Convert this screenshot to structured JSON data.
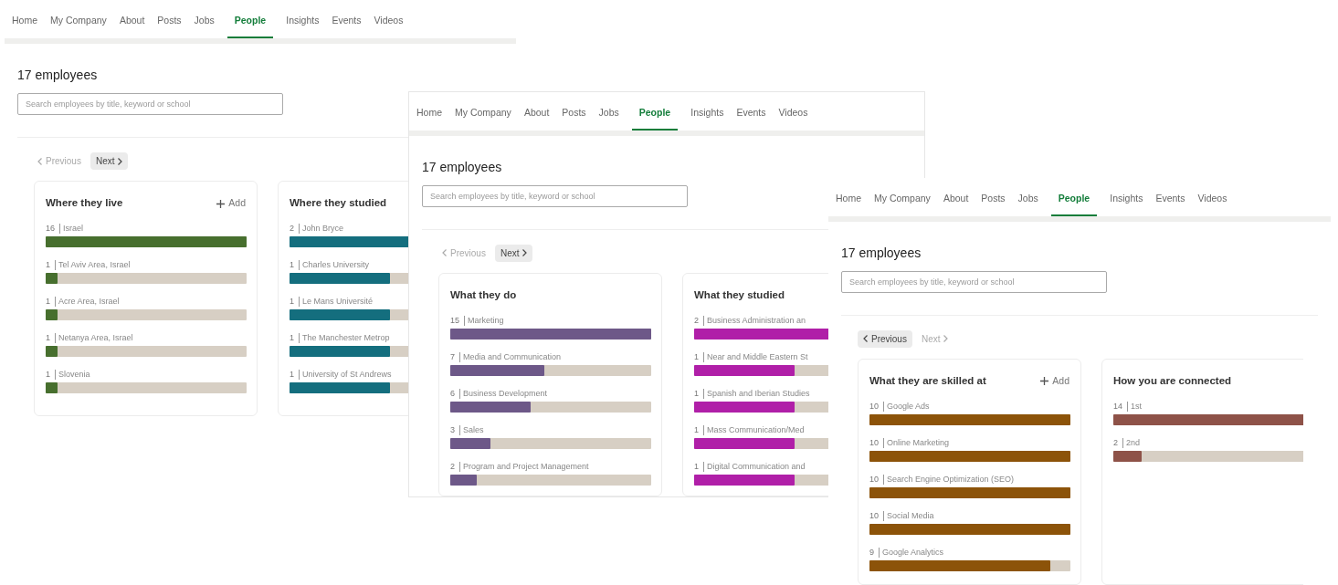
{
  "windows": [
    {
      "tabs": [
        {
          "label": "Home",
          "selected": false
        },
        {
          "label": "My Company",
          "selected": false
        },
        {
          "label": "About",
          "selected": false
        },
        {
          "label": "Posts",
          "selected": false
        },
        {
          "label": "Jobs",
          "selected": false
        },
        {
          "label": "People",
          "selected": true
        },
        {
          "label": "Insights",
          "selected": false
        },
        {
          "label": "Events",
          "selected": false
        },
        {
          "label": "Videos",
          "selected": false
        }
      ],
      "heading": "17 employees",
      "search": {
        "placeholder": "Search employees by title, keyword or school"
      },
      "previous": {
        "label": "Previous",
        "disabled": true
      },
      "next": {
        "label": "Next",
        "disabled": false
      },
      "cards": [
        {
          "title": "Where they live",
          "add": "Add",
          "color": "#476f2e",
          "rows": [
            {
              "count": "16",
              "label": "Israel",
              "level": 1
            },
            {
              "count": "1",
              "label": "Tel Aviv Area, Israel",
              "level": 0.06
            },
            {
              "count": "1",
              "label": "Acre Area, Israel",
              "level": 0.06
            },
            {
              "count": "1",
              "label": "Netanya Area, Israel",
              "level": 0.06
            },
            {
              "count": "1",
              "label": "Slovenia",
              "level": 0.06
            }
          ]
        },
        {
          "title": "Where they studied",
          "color": "#146e7e",
          "rows": [
            {
              "count": "2",
              "label": "John Bryce",
              "level": 1
            },
            {
              "count": "1",
              "label": "Charles University",
              "level": 0.5
            },
            {
              "count": "1",
              "label": "Le Mans Université",
              "level": 0.5
            },
            {
              "count": "1",
              "label": "The Manchester Metrop",
              "level": 0.5
            },
            {
              "count": "1",
              "label": "University of St Andrews",
              "level": 0.5
            }
          ]
        }
      ]
    },
    {
      "tabs": [
        {
          "label": "Home",
          "selected": false
        },
        {
          "label": "My Company",
          "selected": false
        },
        {
          "label": "About",
          "selected": false
        },
        {
          "label": "Posts",
          "selected": false
        },
        {
          "label": "Jobs",
          "selected": false
        },
        {
          "label": "People",
          "selected": true
        },
        {
          "label": "Insights",
          "selected": false
        },
        {
          "label": "Events",
          "selected": false
        },
        {
          "label": "Videos",
          "selected": false
        }
      ],
      "heading": "17 employees",
      "search": {
        "placeholder": "Search employees by title, keyword or school"
      },
      "previous": {
        "label": "Previous",
        "disabled": true
      },
      "next": {
        "label": "Next",
        "disabled": false
      },
      "cards": [
        {
          "title": "What they do",
          "color": "#6d5888",
          "rows": [
            {
              "count": "15",
              "label": "Marketing",
              "level": 1
            },
            {
              "count": "7",
              "label": "Media and Communication",
              "level": 0.47
            },
            {
              "count": "6",
              "label": "Business Development",
              "level": 0.4
            },
            {
              "count": "3",
              "label": "Sales",
              "level": 0.2
            },
            {
              "count": "2",
              "label": "Program and Project Management",
              "level": 0.13
            }
          ]
        },
        {
          "title": "What they studied",
          "color": "#b01fa8",
          "rows": [
            {
              "count": "2",
              "label": "Business Administration an",
              "level": 1
            },
            {
              "count": "1",
              "label": "Near and Middle Eastern St",
              "level": 0.5
            },
            {
              "count": "1",
              "label": "Spanish and Iberian Studies",
              "level": 0.5
            },
            {
              "count": "1",
              "label": "Mass Communication/Med",
              "level": 0.5
            },
            {
              "count": "1",
              "label": "Digital Communication and",
              "level": 0.5
            }
          ]
        }
      ]
    },
    {
      "tabs": [
        {
          "label": "Home",
          "selected": false
        },
        {
          "label": "My Company",
          "selected": false
        },
        {
          "label": "About",
          "selected": false
        },
        {
          "label": "Posts",
          "selected": false
        },
        {
          "label": "Jobs",
          "selected": false
        },
        {
          "label": "People",
          "selected": true
        },
        {
          "label": "Insights",
          "selected": false
        },
        {
          "label": "Events",
          "selected": false
        },
        {
          "label": "Videos",
          "selected": false
        }
      ],
      "heading": "17 employees",
      "search": {
        "placeholder": "Search employees by title, keyword or school"
      },
      "previous": {
        "label": "Previous",
        "disabled": false
      },
      "next": {
        "label": "Next",
        "disabled": true
      },
      "cards": [
        {
          "title": "What they are skilled at",
          "add": "Add",
          "color": "#8c5309",
          "rows": [
            {
              "count": "10",
              "label": "Google Ads",
              "level": 1
            },
            {
              "count": "10",
              "label": "Online Marketing",
              "level": 1
            },
            {
              "count": "10",
              "label": "Search Engine Optimization (SEO)",
              "level": 1
            },
            {
              "count": "10",
              "label": "Social Media",
              "level": 1
            },
            {
              "count": "9",
              "label": "Google Analytics",
              "level": 0.9
            }
          ]
        },
        {
          "title": "How you are connected",
          "color": "#8e5248",
          "rows": [
            {
              "count": "14",
              "label": "1st",
              "level": 1
            },
            {
              "count": "2",
              "label": "2nd",
              "level": 0.14
            }
          ]
        }
      ]
    }
  ]
}
